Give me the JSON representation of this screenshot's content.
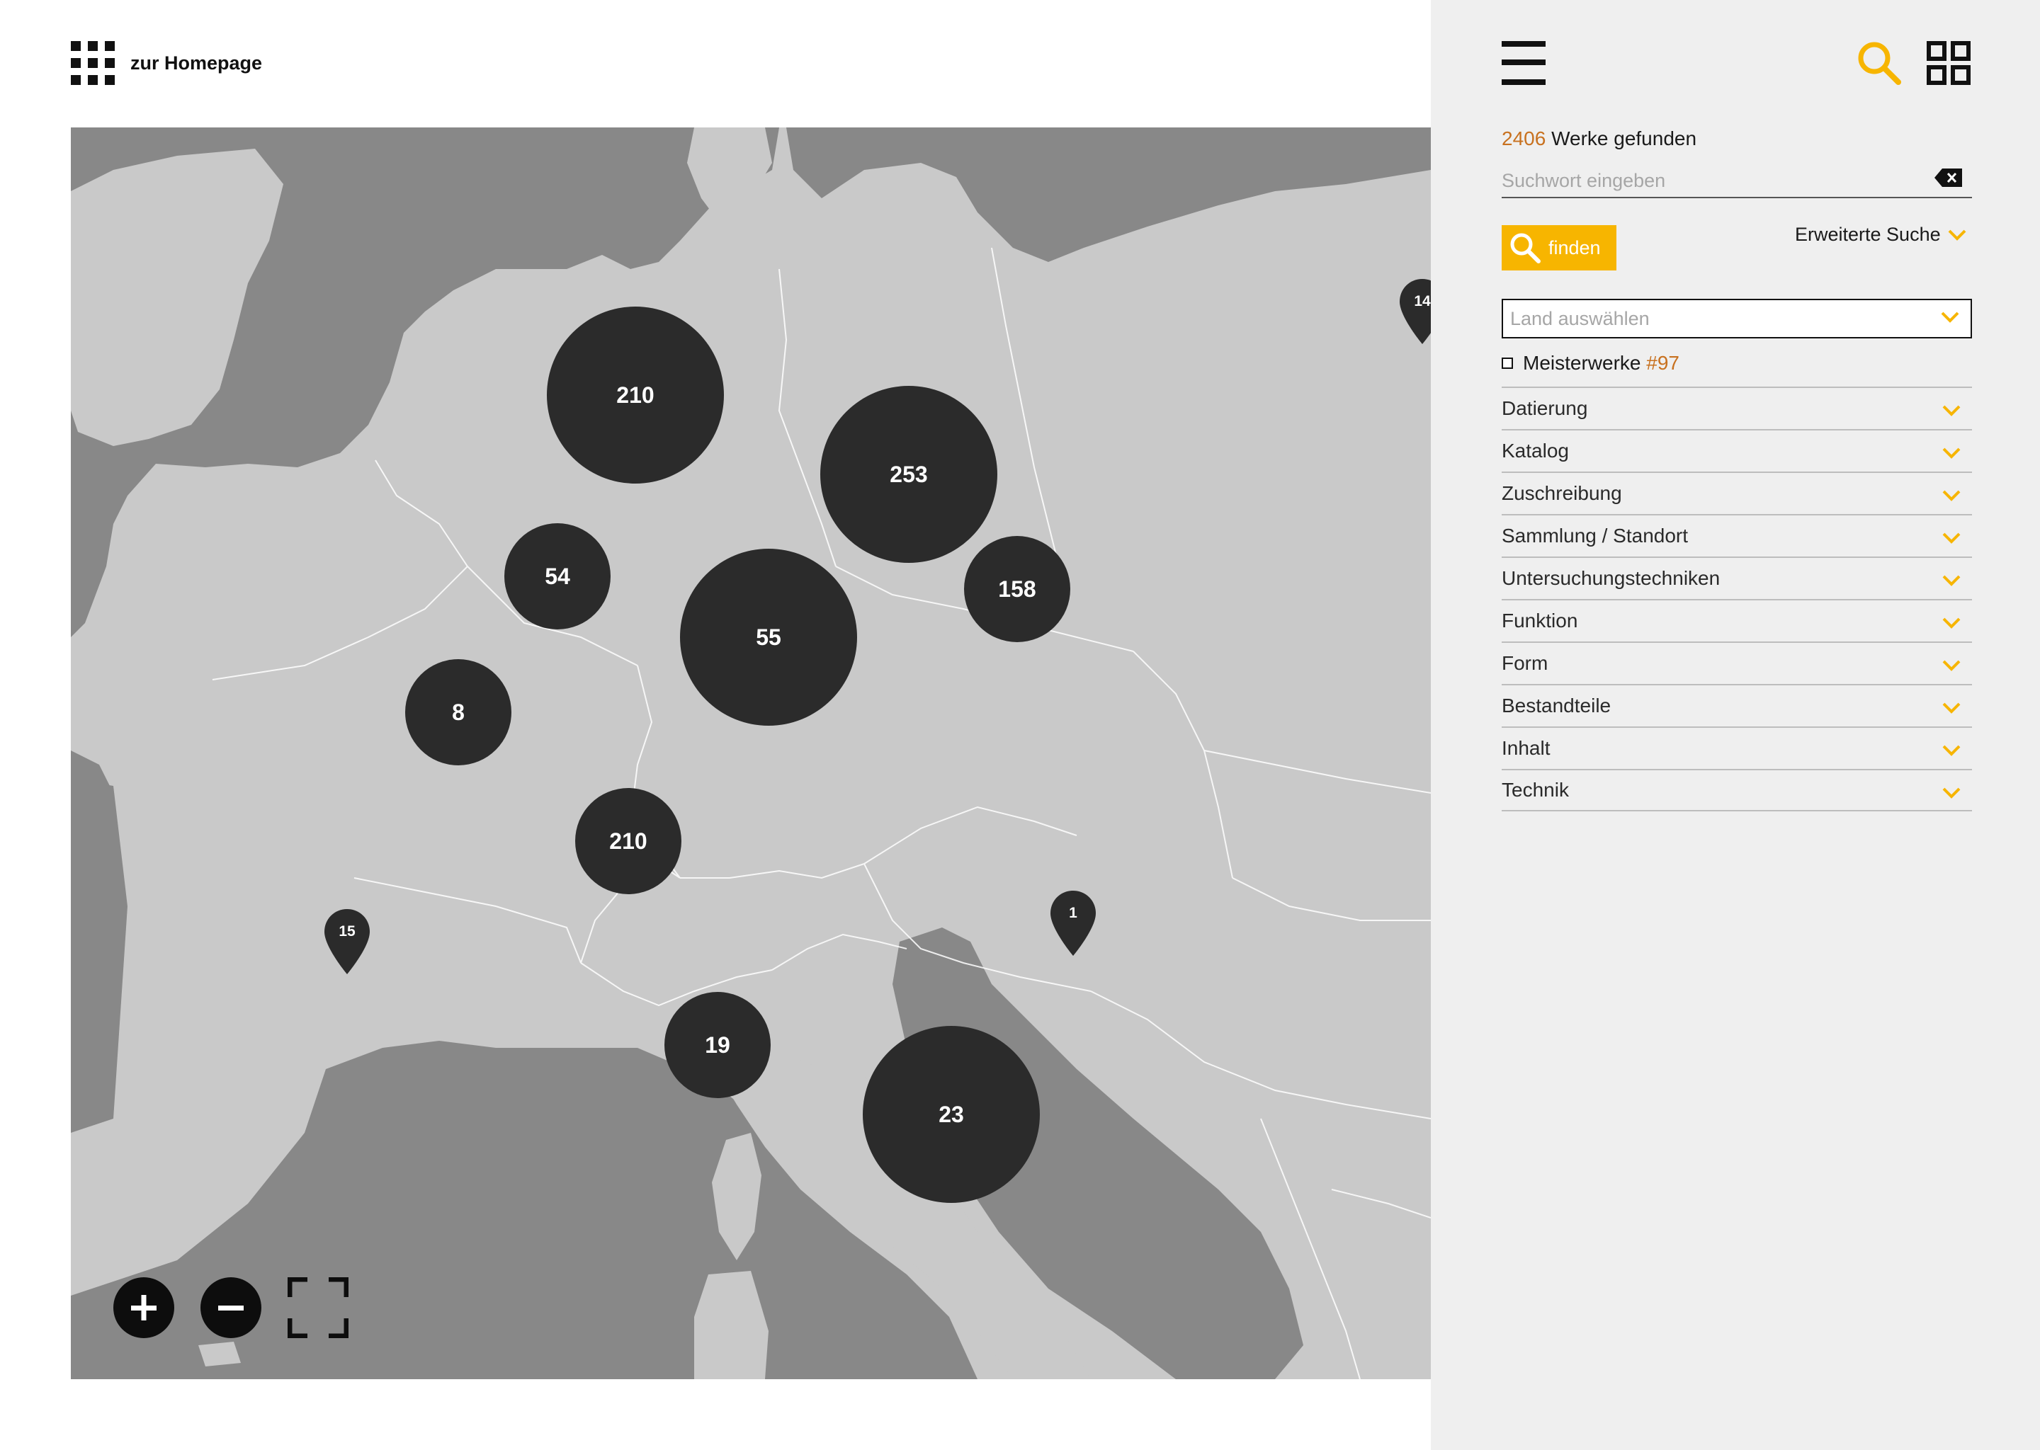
{
  "header": {
    "home_label": "zur Homepage"
  },
  "map": {
    "clusters": [
      {
        "label": "210"
      },
      {
        "label": "253"
      },
      {
        "label": "54"
      },
      {
        "label": "55"
      },
      {
        "label": "158"
      },
      {
        "label": "8"
      },
      {
        "label": "210"
      },
      {
        "label": "19"
      },
      {
        "label": "23"
      }
    ],
    "pins": [
      {
        "label": "14"
      },
      {
        "label": "15"
      },
      {
        "label": "1"
      }
    ],
    "controls": {
      "zoom_in_icon": "plus-icon",
      "zoom_out_icon": "minus-icon",
      "fullscreen_icon": "fullscreen-icon"
    }
  },
  "sidebar": {
    "results_count": "2406",
    "results_label": " Werke gefunden",
    "search_placeholder": "Suchwort eingeben",
    "find_label": "finden",
    "advanced_label": "Erweiterte Suche",
    "country_placeholder": "Land auswählen",
    "masterworks_label": "Meisterwerke ",
    "masterworks_count": "#97",
    "facets": [
      {
        "label": "Datierung"
      },
      {
        "label": "Katalog"
      },
      {
        "label": "Zuschreibung"
      },
      {
        "label": "Sammlung / Standort"
      },
      {
        "label": "Untersuchungstechniken"
      },
      {
        "label": "Funktion"
      },
      {
        "label": "Form"
      },
      {
        "label": "Bestandteile"
      },
      {
        "label": "Inhalt"
      },
      {
        "label": "Technik"
      }
    ]
  },
  "colors": {
    "accent": "#f7b500",
    "count": "#c8711f",
    "water": "#888888",
    "land": "#c9c9c9",
    "cluster": "#2b2b2b"
  }
}
